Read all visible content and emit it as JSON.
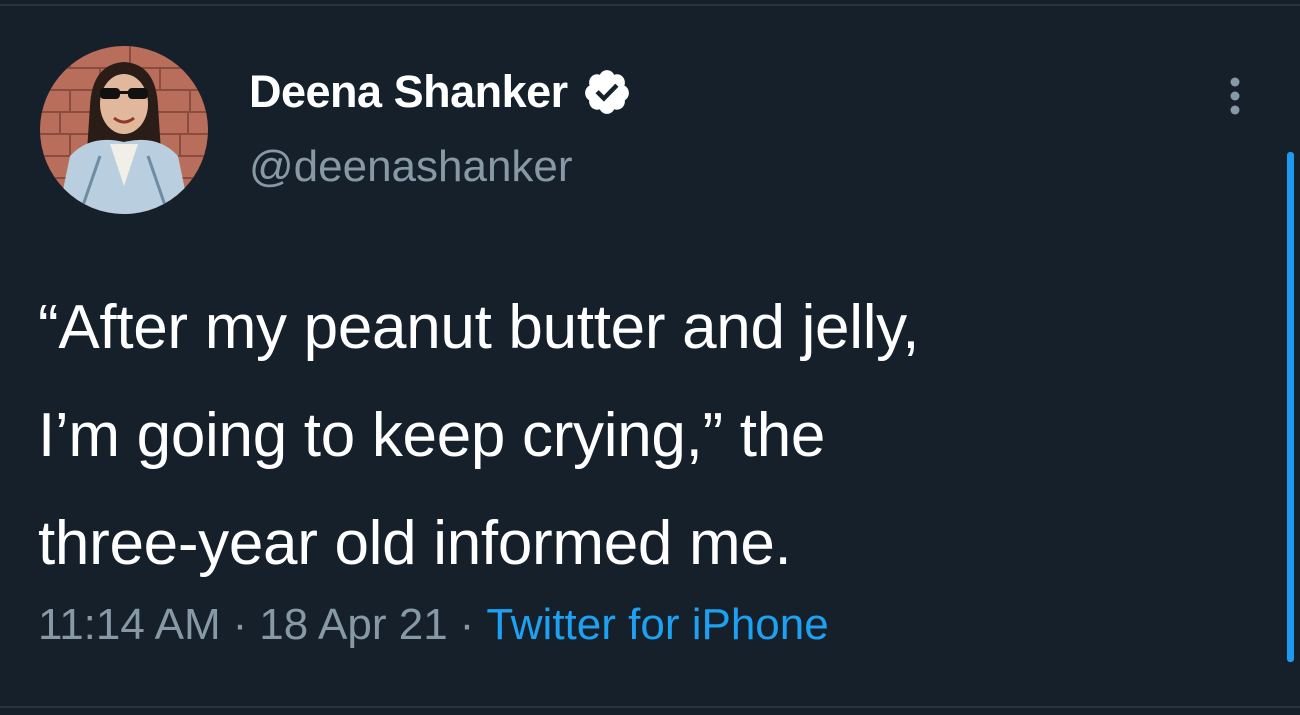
{
  "author": {
    "display_name": "Deena Shanker",
    "handle": "@deenashanker",
    "verified": true
  },
  "tweet": {
    "text_lines": [
      "“After my peanut butter and jelly,",
      "I’m going to keep crying,” the",
      "three-year old informed me."
    ]
  },
  "meta": {
    "time": "11:14 AM",
    "separator": "·",
    "date": "18 Apr 21",
    "source": "Twitter for iPhone"
  },
  "icons": {
    "verified": "verified-badge-icon",
    "more": "more-options-icon"
  },
  "colors": {
    "background": "#15202b",
    "text": "#ffffff",
    "secondary": "#8899a6",
    "accent": "#1da1f2"
  }
}
